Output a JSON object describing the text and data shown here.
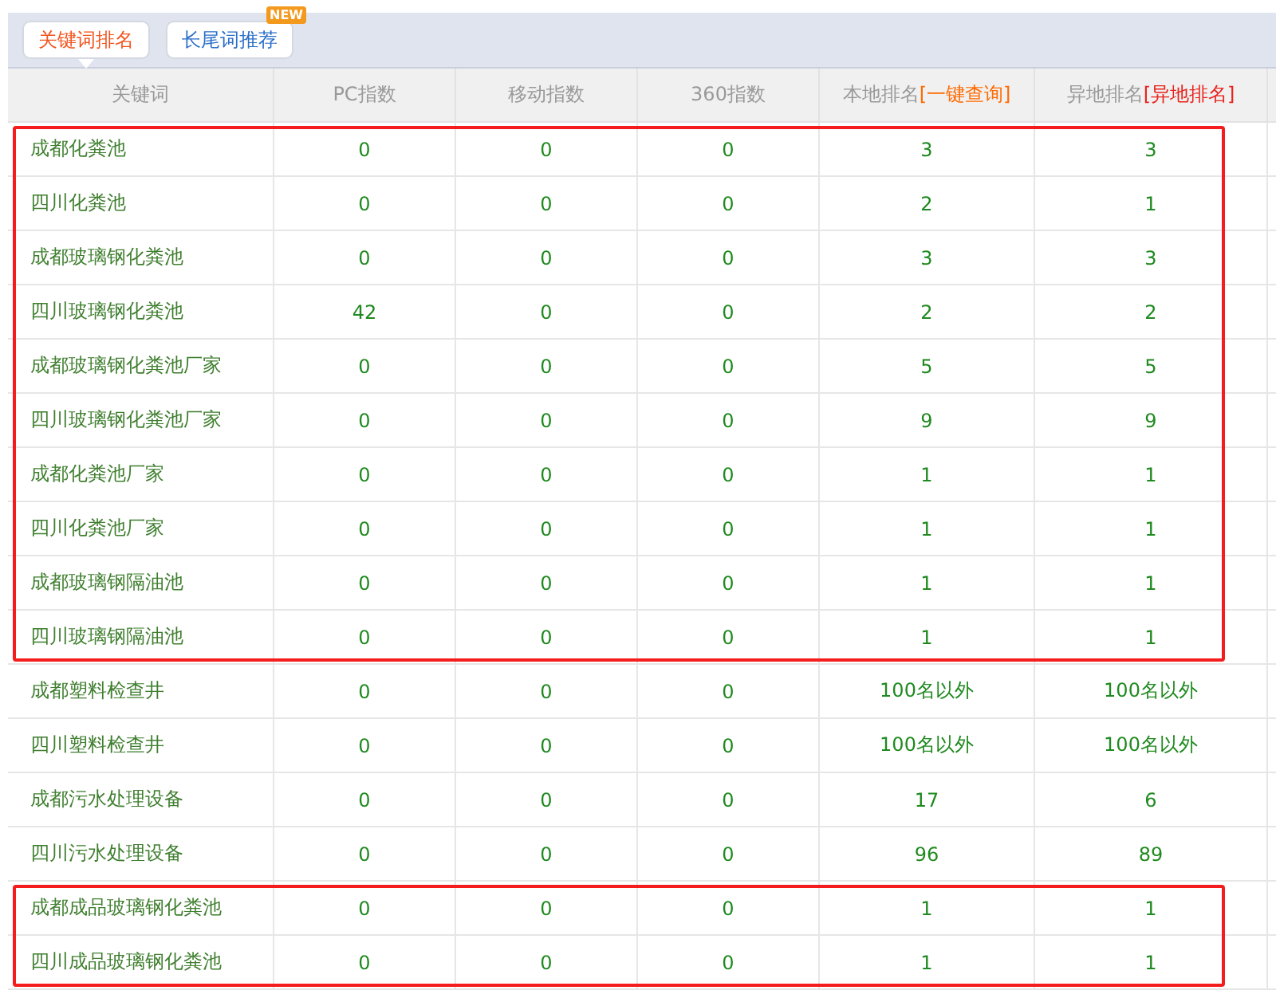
{
  "tabs": [
    {
      "label": "关键词排名",
      "selected": true
    },
    {
      "label": "长尾词推荐",
      "selected": false,
      "badge": "NEW"
    }
  ],
  "table": {
    "columns": [
      {
        "label": "关键词"
      },
      {
        "label": "PC指数"
      },
      {
        "label": "移动指数"
      },
      {
        "label": "360指数"
      },
      {
        "label": "本地排名",
        "link": "[一键查询]",
        "kind": "query"
      },
      {
        "label": "异地排名",
        "link": "[异地排名]",
        "kind": "remote"
      }
    ],
    "row_groups": [
      {
        "highlighted": true,
        "rows": [
          [
            "成都化粪池",
            "0",
            "0",
            "0",
            "3",
            "3"
          ],
          [
            "四川化粪池",
            "0",
            "0",
            "0",
            "2",
            "1"
          ],
          [
            "成都玻璃钢化粪池",
            "0",
            "0",
            "0",
            "3",
            "3"
          ],
          [
            "四川玻璃钢化粪池",
            "42",
            "0",
            "0",
            "2",
            "2"
          ],
          [
            "成都玻璃钢化粪池厂家",
            "0",
            "0",
            "0",
            "5",
            "5"
          ],
          [
            "四川玻璃钢化粪池厂家",
            "0",
            "0",
            "0",
            "9",
            "9"
          ],
          [
            "成都化粪池厂家",
            "0",
            "0",
            "0",
            "1",
            "1"
          ],
          [
            "四川化粪池厂家",
            "0",
            "0",
            "0",
            "1",
            "1"
          ],
          [
            "成都玻璃钢隔油池",
            "0",
            "0",
            "0",
            "1",
            "1"
          ],
          [
            "四川玻璃钢隔油池",
            "0",
            "0",
            "0",
            "1",
            "1"
          ]
        ]
      },
      {
        "highlighted": false,
        "rows": [
          [
            "成都塑料检查井",
            "0",
            "0",
            "0",
            "100名以外",
            "100名以外"
          ],
          [
            "四川塑料检查井",
            "0",
            "0",
            "0",
            "100名以外",
            "100名以外"
          ],
          [
            "成都污水处理设备",
            "0",
            "0",
            "0",
            "17",
            "6"
          ],
          [
            "四川污水处理设备",
            "0",
            "0",
            "0",
            "96",
            "89"
          ]
        ]
      },
      {
        "highlighted": true,
        "rows": [
          [
            "成都成品玻璃钢化粪池",
            "0",
            "0",
            "0",
            "1",
            "1"
          ],
          [
            "四川成品玻璃钢化粪池",
            "0",
            "0",
            "0",
            "1",
            "1"
          ]
        ]
      }
    ]
  }
}
